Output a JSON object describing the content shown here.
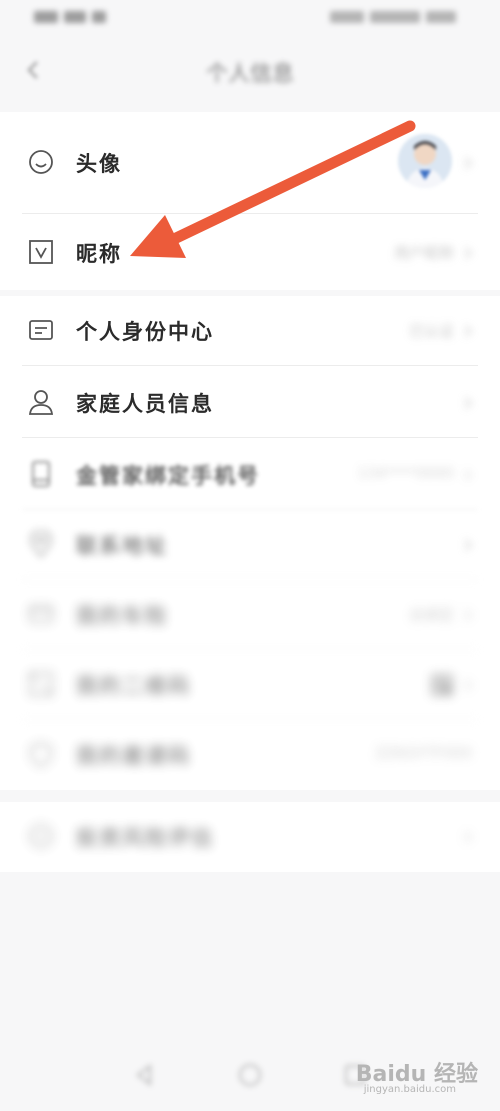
{
  "header": {
    "title": "个人信息"
  },
  "rows": [
    {
      "label": "头像",
      "icon": "smile-icon"
    },
    {
      "label": "昵称",
      "icon": "nickname-icon",
      "value": "用户昵称"
    },
    {
      "label": "个人身份中心",
      "icon": "id-card-icon",
      "value": "已认证"
    },
    {
      "label": "家庭人员信息",
      "icon": "person-icon"
    },
    {
      "label": "金管家绑定手机号",
      "icon": "phone-icon",
      "value": "134****0000"
    },
    {
      "label": "联系地址",
      "icon": "location-icon"
    },
    {
      "label": "我的车险",
      "icon": "car-icon",
      "value": "去绑定"
    },
    {
      "label": "我的二维码",
      "icon": "qrcode-icon"
    },
    {
      "label": "我的邀请码",
      "icon": "shield-icon",
      "value": "ZZKGYTF000"
    },
    {
      "label": "投资风险评估",
      "icon": "assessment-icon"
    }
  ],
  "watermark": {
    "text": "Baidu 经验",
    "sub": "jingyan.baidu.com"
  },
  "colors": {
    "arrow": "#ec5b3a",
    "background": "#f7f7f8",
    "card": "#ffffff"
  }
}
